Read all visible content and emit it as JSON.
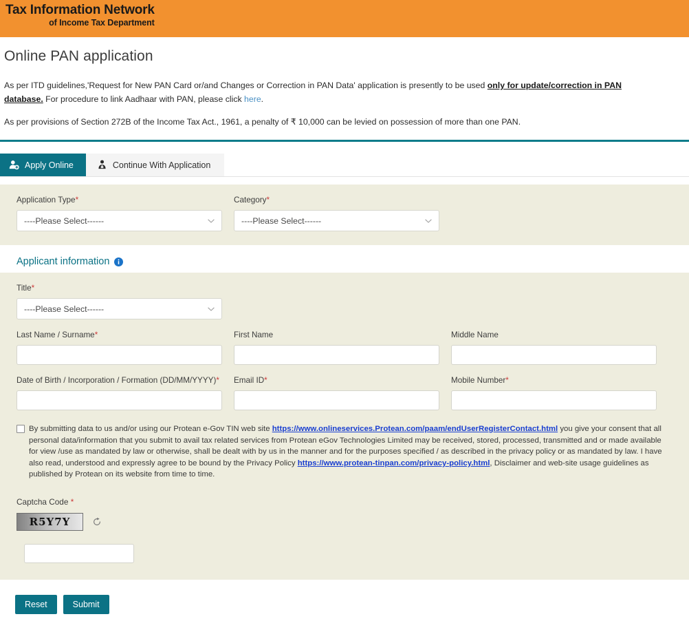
{
  "banner": {
    "logo_line1": "Tax Information Network",
    "logo_line2": "of Income Tax Department",
    "background_color": "#f2912f"
  },
  "page": {
    "title": "Online PAN application",
    "accent_color": "#0b7285",
    "panel_color": "#eeedde"
  },
  "intro": {
    "para1_before": "As per ITD guidelines,'Request for New PAN Card or/and Changes or Correction in PAN Data' application is presently to be used ",
    "para1_emphasis": "only for update/correction in PAN database.",
    "para1_after": " For procedure to link Aadhaar with PAN, please click ",
    "para1_link": "here",
    "para1_end": ".",
    "para2": "As per provisions of Section 272B of the Income Tax Act., 1961, a penalty of ₹ 10,000 can be levied on possession of more than one PAN."
  },
  "tabs": [
    {
      "label": "Apply Online",
      "icon": "user-add-icon",
      "active": true
    },
    {
      "label": "Continue With Application",
      "icon": "user-upload-icon",
      "active": false
    }
  ],
  "top_form": {
    "fields": [
      {
        "label": "Application Type",
        "required": true,
        "value": "----Please Select------",
        "name": "application-type"
      },
      {
        "label": "Category",
        "required": true,
        "value": "----Please Select------",
        "name": "category"
      }
    ]
  },
  "applicant": {
    "heading": "Applicant information",
    "info_icon": "info-icon",
    "title_field": {
      "label": "Title",
      "required": true,
      "value": "----Please Select------"
    },
    "name_row": [
      {
        "label": "Last Name / Surname",
        "required": true,
        "value": ""
      },
      {
        "label": "First Name",
        "required": false,
        "value": ""
      },
      {
        "label": "Middle Name",
        "required": false,
        "value": ""
      }
    ],
    "contact_row": [
      {
        "label": "Date of Birth / Incorporation / Formation (DD/MM/YYYY)",
        "required": true,
        "value": ""
      },
      {
        "label": "Email ID",
        "required": true,
        "value": ""
      },
      {
        "label": "Mobile Number",
        "required": true,
        "value": ""
      }
    ],
    "consent": {
      "checked": false,
      "text_1": "By submitting data to us and/or using our Protean e-Gov TIN web site ",
      "link_1": "https://www.onlineservices.Protean.com/paam/endUserRegisterContact.html",
      "text_2": " you give your consent that all personal data/information that you submit to avail tax related services from Protean eGov Technologies Limited may be received, stored, processed, transmitted and or made available for view /use as mandated by law or otherwise, shall be dealt with by us in the manner and for the purposes specified / as described in the privacy policy or as mandated by law. I have also read, understood and expressly agree to be bound by the Privacy Policy ",
      "link_2": "https://www.protean-tinpan.com/privacy-policy.html",
      "text_3": ", Disclaimer and web-site usage guidelines as published by Protean on its website from time to time."
    },
    "captcha": {
      "label": "Captcha Code ",
      "required": true,
      "code": "R5Y7Y",
      "refresh_icon": "refresh-icon",
      "input_value": ""
    }
  },
  "footer": {
    "reset_label": "Reset",
    "submit_label": "Submit"
  }
}
